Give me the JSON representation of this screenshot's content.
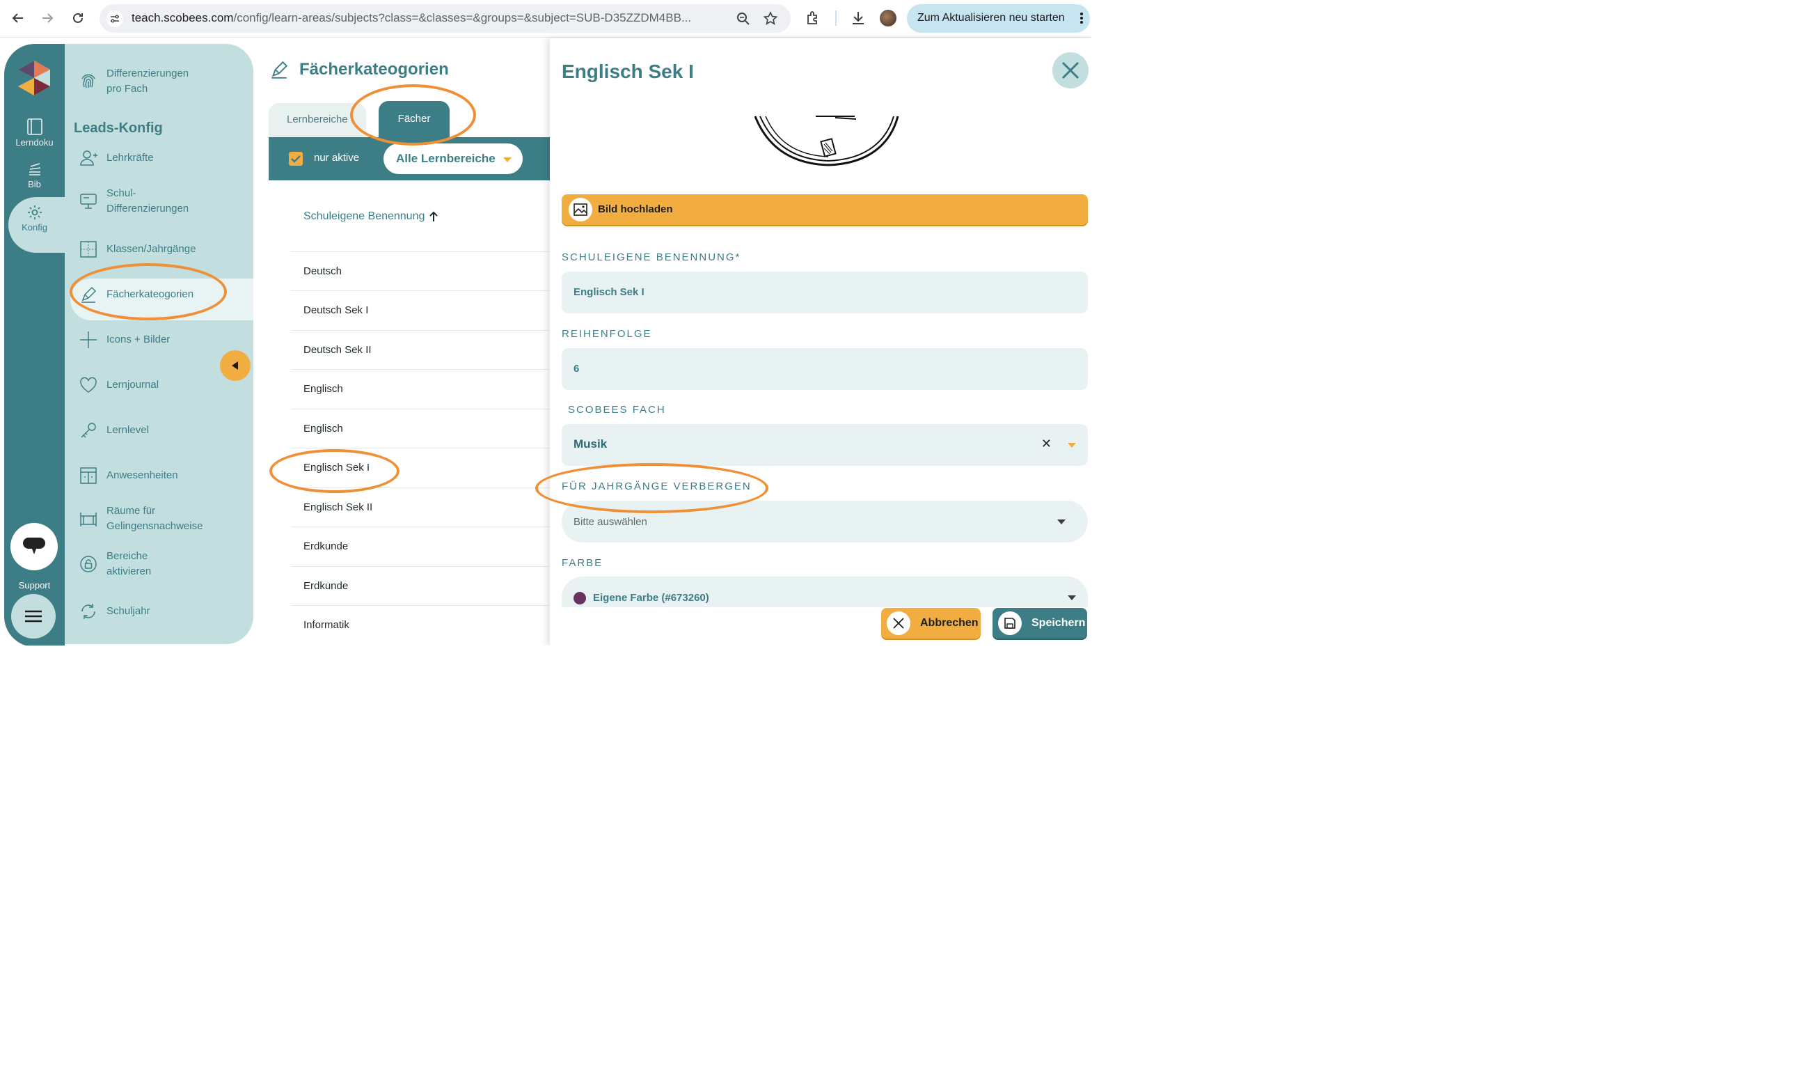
{
  "browser": {
    "url_host": "teach.scobees.com",
    "url_path": "/config/learn-areas/subjects?class=&classes=&groups=&subject=SUB-D35ZZDM4BB...",
    "restart_label": "Zum Aktualisieren neu starten"
  },
  "rail": {
    "items": [
      {
        "label": "Lerndoku",
        "icon": "book-icon"
      },
      {
        "label": "Bib",
        "icon": "library-icon"
      },
      {
        "label": "Konfig",
        "icon": "gear-icon"
      }
    ],
    "support_label": "Support"
  },
  "menu": {
    "top_item": "Differenzierungen pro Fach",
    "heading": "Leads-Konfig",
    "items": [
      {
        "label": "Lehrkräfte",
        "icon": "user-plus-icon"
      },
      {
        "label": "Schul-Differenzierungen",
        "icon": "board-icon"
      },
      {
        "label": "Klassen/Jahrgänge",
        "icon": "grid-icon"
      },
      {
        "label": "Fächerkateogorien",
        "icon": "pen-icon"
      },
      {
        "label": "Icons + Bilder",
        "icon": "plus-icon"
      },
      {
        "label": "Lernjournal",
        "icon": "heart-icon"
      },
      {
        "label": "Lernlevel",
        "icon": "key-icon"
      },
      {
        "label": "Anwesenheiten",
        "icon": "attendance-icon"
      },
      {
        "label": "Räume für Gelingensnachweise",
        "icon": "room-icon"
      },
      {
        "label": "Bereiche aktivieren",
        "icon": "lock-icon"
      },
      {
        "label": "Schuljahr",
        "icon": "cycle-icon"
      }
    ]
  },
  "main": {
    "title": "Fächerkateogorien",
    "tabs": [
      {
        "label": "Lernbereiche",
        "active": false
      },
      {
        "label": "Fächer",
        "active": true
      }
    ],
    "filter": {
      "checkbox_label": "nur aktive",
      "checked": true,
      "dropdown_label": "Alle Lernbereiche"
    },
    "column_header": "Schuleigene Benennung",
    "rows": [
      "Deutsch",
      "Deutsch Sek I",
      "Deutsch Sek II",
      "Englisch",
      "Englisch",
      "Englisch Sek I",
      "Englisch Sek II",
      "Erdkunde",
      "Erdkunde",
      "Informatik"
    ]
  },
  "panel": {
    "title": "Englisch Sek I",
    "upload_label": "Bild hochladen",
    "name_label": "SCHULEIGENE BENENNUNG*",
    "name_value": "Englisch Sek I",
    "order_label": "REIHENFOLGE",
    "order_value": "6",
    "subject_label": "SCOBEES FACH",
    "subject_value": "Musik",
    "hide_label": "FÜR JAHRGÄNGE VERBERGEN",
    "hide_placeholder": "Bitte auswählen",
    "color_label": "FARBE",
    "color_value": "Eigene Farbe (#673260)",
    "color_hex": "#673260",
    "cancel_label": "Abbrechen",
    "save_label": "Speichern"
  },
  "colors": {
    "brand_teal": "#3d7e86",
    "light_teal": "#c2dede",
    "accent_orange": "#f2ad41",
    "annotation_orange": "#ef8f36"
  }
}
